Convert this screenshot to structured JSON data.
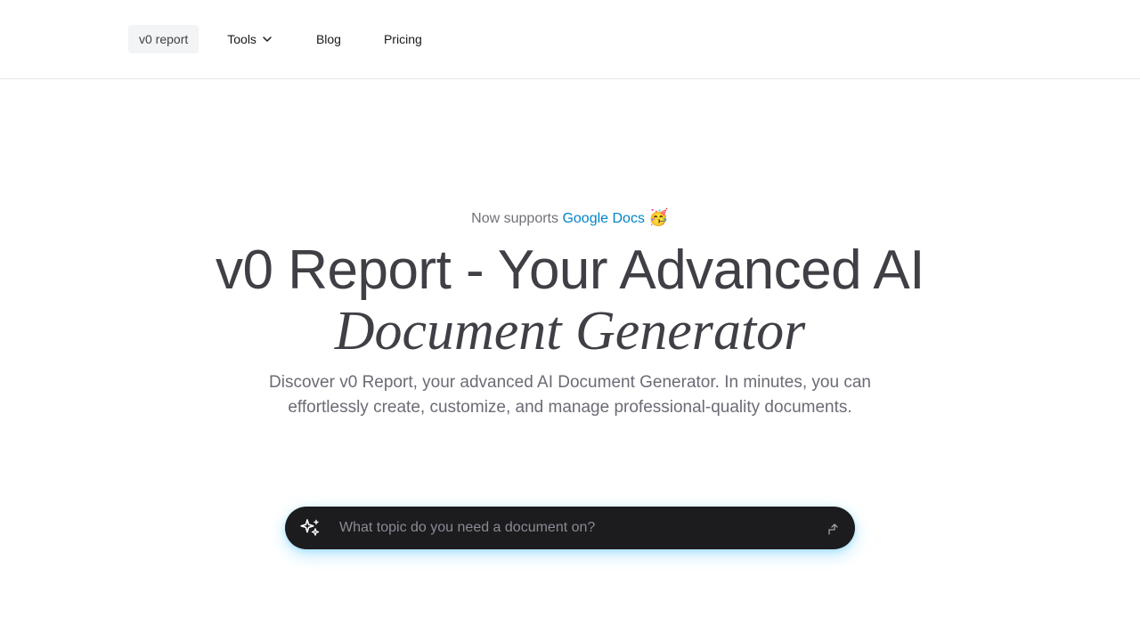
{
  "nav": {
    "brand_label": "v0 report",
    "tools_label": "Tools",
    "blog_label": "Blog",
    "pricing_label": "Pricing"
  },
  "hero": {
    "announce_prefix": "Now supports",
    "announce_link": "Google Docs",
    "announce_emoji": "🥳",
    "headline_line1": "v0 Report - Your Advanced AI",
    "headline_line2": "Document Generator",
    "subtitle": "Discover v0 Report, your advanced AI Document Generator. In minutes, you can effortlessly create, customize, and manage professional-quality documents."
  },
  "search": {
    "placeholder": "What topic do you need a document on?",
    "value": ""
  },
  "icons": {
    "tools_dropdown": "chevron-down-icon",
    "search_leading": "sparkles-icon",
    "submit": "arrow-up-right-icon"
  },
  "colors": {
    "link": "#0284c7",
    "search_bg": "#1c1c1f",
    "search_glow": "#38bdf8",
    "brand_bg": "#f3f4f6"
  }
}
